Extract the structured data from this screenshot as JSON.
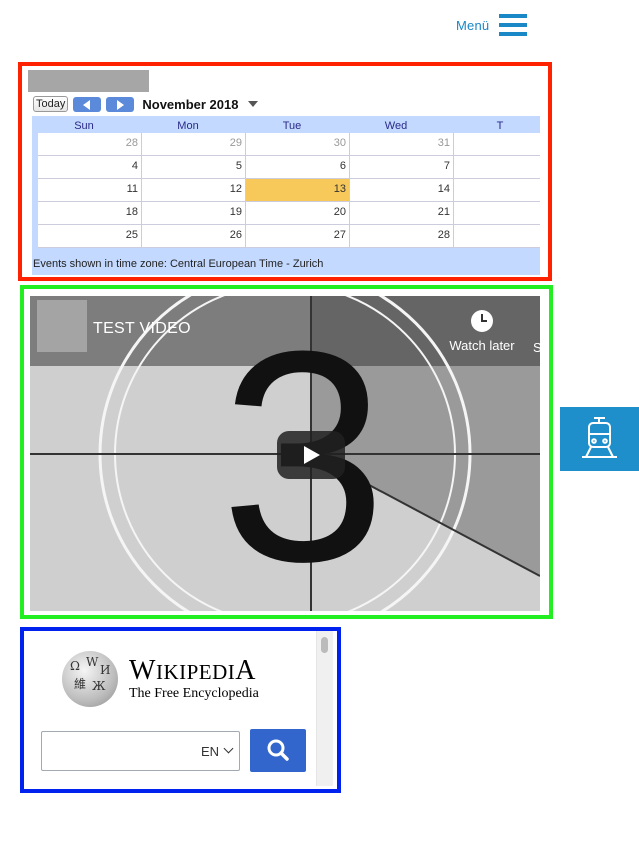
{
  "header": {
    "menu_label": "Menü"
  },
  "calendar": {
    "today_label": "Today",
    "month_title": "November 2018",
    "days_of_week": [
      "Sun",
      "Mon",
      "Tue",
      "Wed",
      "T"
    ],
    "weeks": [
      [
        {
          "d": "28",
          "other": true
        },
        {
          "d": "29",
          "other": true
        },
        {
          "d": "30",
          "other": true
        },
        {
          "d": "31",
          "other": true
        },
        {
          "d": "",
          "other": false
        }
      ],
      [
        {
          "d": "4",
          "other": false
        },
        {
          "d": "5",
          "other": false
        },
        {
          "d": "6",
          "other": false
        },
        {
          "d": "7",
          "other": false
        },
        {
          "d": "",
          "other": false
        }
      ],
      [
        {
          "d": "11",
          "other": false
        },
        {
          "d": "12",
          "other": false
        },
        {
          "d": "13",
          "other": false,
          "today": true
        },
        {
          "d": "14",
          "other": false
        },
        {
          "d": "",
          "other": false
        }
      ],
      [
        {
          "d": "18",
          "other": false
        },
        {
          "d": "19",
          "other": false
        },
        {
          "d": "20",
          "other": false
        },
        {
          "d": "21",
          "other": false
        },
        {
          "d": "",
          "other": false
        }
      ],
      [
        {
          "d": "25",
          "other": false
        },
        {
          "d": "26",
          "other": false
        },
        {
          "d": "27",
          "other": false
        },
        {
          "d": "28",
          "other": false
        },
        {
          "d": "",
          "other": false
        }
      ]
    ],
    "timezone_note": "Events shown in time zone: Central European Time - Zurich",
    "today_color": "#f7c95a",
    "nav_button_color": "#5a8ad9"
  },
  "video": {
    "title": "TEST VIDEO",
    "watch_later_label": "Watch later",
    "share_label_cut": "S",
    "countdown_number": "3"
  },
  "train_button": {
    "icon": "train-icon",
    "color": "#1f8fcc"
  },
  "wikipedia": {
    "title_main": "WIKIPEDIA",
    "subtitle": "The Free Encyclopedia",
    "language": "EN",
    "search_value": "",
    "button_color": "#3366cc"
  },
  "highlight_colors": {
    "red": "#ff2200",
    "green": "#22ee22",
    "blue": "#0022ee"
  }
}
